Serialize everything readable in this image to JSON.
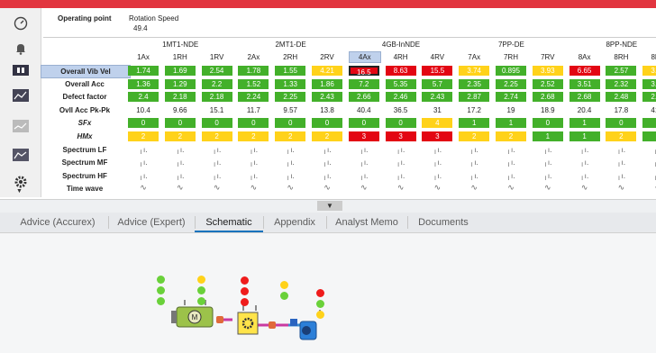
{
  "header": {
    "operating_point": "Operating point",
    "rotation_speed_label": "Rotation Speed",
    "rotation_speed_value": "49.4"
  },
  "groups": [
    "1MT1-NDE",
    "2MT1-DE",
    "4GB-InNDE",
    "7PP-DE",
    "8PP-NDE"
  ],
  "columns": [
    "1Ax",
    "1RH",
    "1RV",
    "2Ax",
    "2RH",
    "2RV",
    "4Ax",
    "4RH",
    "4RV",
    "7Ax",
    "7RH",
    "7RV",
    "8Ax",
    "8RH",
    "8RV"
  ],
  "selected_column": "4Ax",
  "rows": [
    {
      "label": "Overall Vib Vel",
      "style": "colored",
      "values": [
        "1.74",
        "1.69",
        "2.54",
        "1.78",
        "1.55",
        "4.21",
        "16.5",
        "8.63",
        "15.5",
        "3.74",
        "0.895",
        "3.93",
        "6.65",
        "2.57",
        "3.63"
      ],
      "status": [
        "g",
        "g",
        "g",
        "g",
        "g",
        "y",
        "r",
        "r",
        "r",
        "y",
        "g",
        "y",
        "r",
        "g",
        "y"
      ]
    },
    {
      "label": "Overall Acc",
      "style": "colored",
      "values": [
        "1.36",
        "1.29",
        "2.2",
        "1.52",
        "1.33",
        "1.86",
        "7.2",
        "5.35",
        "5.7",
        "2.35",
        "2.25",
        "2.52",
        "3.51",
        "2.32",
        "3.42"
      ],
      "status": [
        "g",
        "g",
        "g",
        "g",
        "g",
        "g",
        "g",
        "g",
        "g",
        "g",
        "g",
        "g",
        "g",
        "g",
        "g"
      ]
    },
    {
      "label": "Defect factor",
      "style": "colored",
      "values": [
        "2.4",
        "2.18",
        "2.18",
        "2.24",
        "2.25",
        "2.43",
        "2.66",
        "2.46",
        "2.43",
        "2.87",
        "2.74",
        "2.68",
        "2.68",
        "2.48",
        "2.92"
      ],
      "status": [
        "g",
        "g",
        "g",
        "g",
        "g",
        "g",
        "g",
        "g",
        "g",
        "g",
        "g",
        "g",
        "g",
        "g",
        "g"
      ]
    },
    {
      "label": "Ovll Acc Pk-Pk",
      "style": "plain",
      "values": [
        "10.4",
        "9.66",
        "15.1",
        "11.7",
        "9.57",
        "13.8",
        "40.4",
        "36.5",
        "31",
        "17.2",
        "19",
        "18.9",
        "20.4",
        "17.8",
        "41.6"
      ]
    },
    {
      "label": "SFx",
      "style": "colored",
      "italic": true,
      "values": [
        "0",
        "0",
        "0",
        "0",
        "0",
        "0",
        "0",
        "0",
        "4",
        "1",
        "1",
        "0",
        "1",
        "0",
        "2"
      ],
      "status": [
        "g",
        "g",
        "g",
        "g",
        "g",
        "g",
        "g",
        "g",
        "y",
        "g",
        "g",
        "g",
        "g",
        "g",
        "g"
      ]
    },
    {
      "label": "HMx",
      "style": "colored",
      "italic": true,
      "values": [
        "2",
        "2",
        "2",
        "2",
        "2",
        "2",
        "3",
        "3",
        "3",
        "2",
        "2",
        "1",
        "1",
        "2",
        "1"
      ],
      "status": [
        "y",
        "y",
        "y",
        "y",
        "y",
        "y",
        "r",
        "r",
        "r",
        "y",
        "y",
        "g",
        "g",
        "y",
        "g"
      ]
    },
    {
      "label": "Spectrum LF",
      "style": "icon",
      "icon": "spectrum"
    },
    {
      "label": "Spectrum MF",
      "style": "icon",
      "icon": "spectrum"
    },
    {
      "label": "Spectrum HF",
      "style": "icon",
      "icon": "spectrum"
    },
    {
      "label": "Time wave",
      "style": "icon",
      "icon": "wave"
    }
  ],
  "selected_row": "Overall Vib Vel",
  "highlight_cell": {
    "row": 0,
    "col": 6
  },
  "tabs": [
    {
      "label": "Advice (Accurex)",
      "active": false
    },
    {
      "label": "Advice (Expert)",
      "active": false
    },
    {
      "label": "Schematic",
      "active": true
    },
    {
      "label": "Appendix",
      "active": false
    },
    {
      "label": "Analyst Memo",
      "active": false
    },
    {
      "label": "Documents",
      "active": false
    }
  ],
  "sidebar_icons": [
    "gauge-icon",
    "bell-icon",
    "filmstrip-icon",
    "chart-window-icon",
    "trend-icon",
    "grid-chart-icon",
    "gear-icon"
  ],
  "colors": {
    "green": "#43b02a",
    "yellow": "#ffd21a",
    "red": "#e30613",
    "accent": "#1473bd"
  },
  "schematic": {
    "motor_label": "M"
  }
}
